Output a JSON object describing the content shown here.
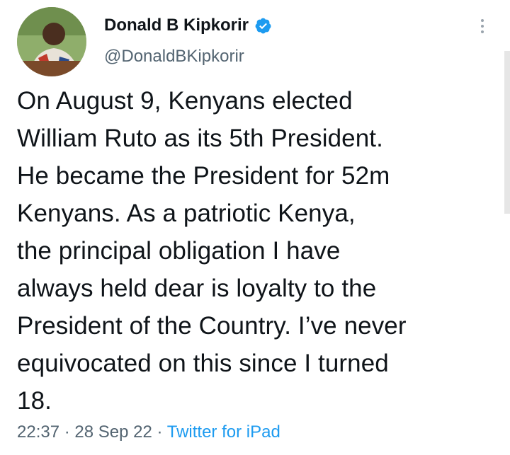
{
  "author": {
    "name": "Donald B Kipkorir",
    "handle": "@DonaldBKipkorir",
    "verified": true,
    "avatar": "profile-photo"
  },
  "tweet": {
    "text": "On August 9, Kenyans elected\nWilliam Ruto as its 5th President.\nHe became the President for 52m\nKenyans. As a patriotic Kenya,\nthe principal obligation I have\nalways held dear is loyalty to the\nPresident of the Country. I’ve never\nequivocated on this since I turned\n18."
  },
  "meta": {
    "time": "22:37",
    "separator": " · ",
    "date": "28 Sep 22",
    "source": "Twitter for iPad"
  },
  "icons": {
    "verified": "verified-badge-icon",
    "more": "more-options-icon"
  },
  "colors": {
    "text": "#0f1419",
    "secondary": "#536471",
    "accent": "#1d9bf0"
  }
}
